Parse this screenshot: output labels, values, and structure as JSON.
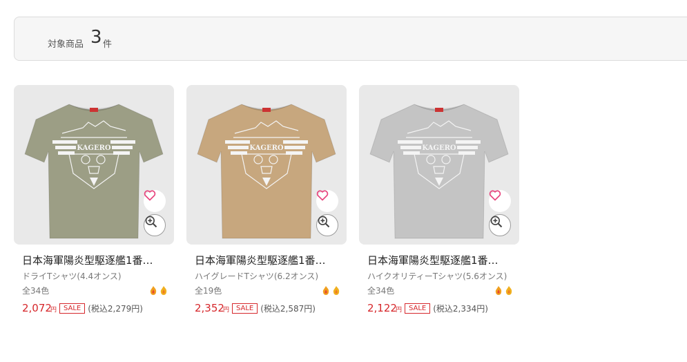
{
  "summary": {
    "label": "対象商品",
    "count": "3",
    "unit": "件"
  },
  "products": [
    {
      "title": "日本海軍陽炎型駆逐艦1番…",
      "type": "ドライTシャツ(4.4オンス)",
      "colors": "全34色",
      "price": "2,072",
      "yen": "円",
      "sale": "SALE",
      "tax_included": "(税込2,279円)",
      "shirt_color": "#9c9e85",
      "print_text": "KAGERO"
    },
    {
      "title": "日本海軍陽炎型駆逐艦1番…",
      "type": "ハイグレードTシャツ(6.2オンス)",
      "colors": "全19色",
      "price": "2,352",
      "yen": "円",
      "sale": "SALE",
      "tax_included": "(税込2,587円)",
      "shirt_color": "#c7a77e",
      "print_text": "KAGERO"
    },
    {
      "title": "日本海軍陽炎型駆逐艦1番…",
      "type": "ハイクオリティーTシャツ(5.6オンス)",
      "colors": "全34色",
      "price": "2,122",
      "yen": "円",
      "sale": "SALE",
      "tax_included": "(税込2,334円)",
      "shirt_color": "#c4c4c4",
      "print_text": "KAGERO"
    }
  ],
  "icons": {
    "favorite": "heart-icon",
    "zoom": "zoom-in-icon",
    "badge": "flame-icon"
  },
  "colors": {
    "accent_red": "#d6262a",
    "heart_pink": "#e8477f"
  }
}
